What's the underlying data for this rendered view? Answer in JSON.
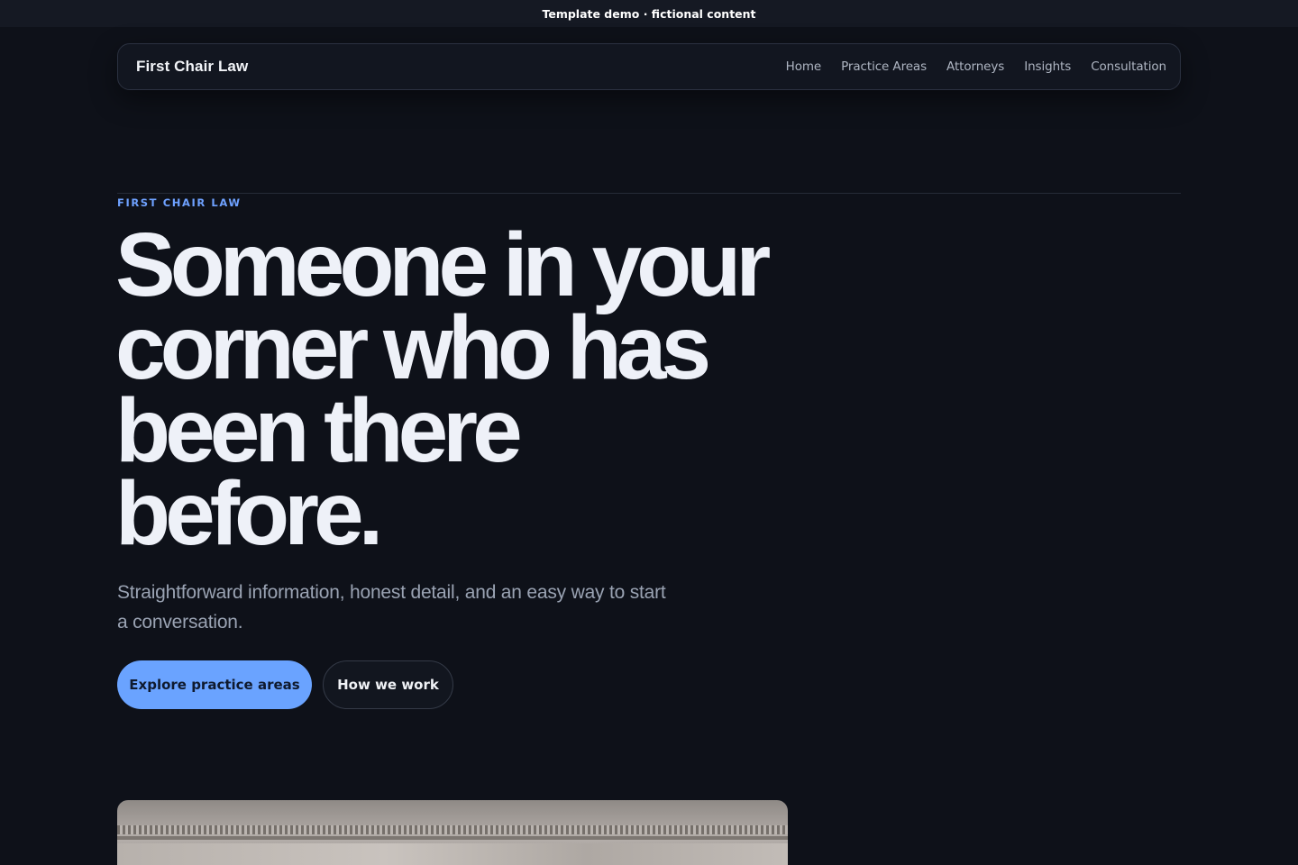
{
  "banner": {
    "text": "Template demo · fictional content"
  },
  "nav": {
    "brand": "First Chair Law",
    "links": [
      "Home",
      "Practice Areas",
      "Attorneys",
      "Insights",
      "Consultation"
    ]
  },
  "hero": {
    "eyebrow": "FIRST CHAIR LAW",
    "headline_lines": [
      "Someone in your",
      "corner who has",
      "been there",
      "before."
    ],
    "subtitle": "Straightforward information, honest detail, and an easy way to start a conversation.",
    "primary_button": "Explore practice areas",
    "secondary_button": "How we work"
  },
  "colors": {
    "background": "#0e1119",
    "accent": "#6aa3ff",
    "text": "#eef1f8",
    "muted": "#9aa3b3"
  }
}
